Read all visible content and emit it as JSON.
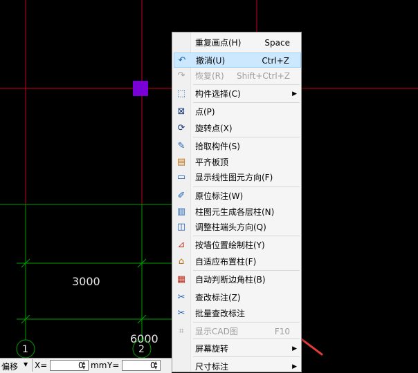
{
  "canvas": {
    "dimension_labels": [
      "3000",
      "6000"
    ],
    "axis_labels": [
      "1",
      "2"
    ]
  },
  "status_bar": {
    "mode_label": "偏移",
    "x_label": "X=",
    "x_value": "0",
    "x_unit": "mm",
    "y_label": "Y=",
    "y_value": "0"
  },
  "menu": {
    "items": [
      {
        "label": "重复画点(H)",
        "shortcut": "Space",
        "icon": "none"
      },
      {
        "label": "撤消(U)",
        "shortcut": "Ctrl+Z",
        "icon": "undo-icon",
        "highlighted": true
      },
      {
        "label": "恢复(R)",
        "shortcut": "Shift+Ctrl+Z",
        "icon": "redo-icon",
        "disabled": true
      },
      {
        "label": "构件选择(C)",
        "shortcut": "",
        "icon": "select-component-icon",
        "submenu": true
      },
      {
        "label": "点(P)",
        "shortcut": "",
        "icon": "point-icon"
      },
      {
        "label": "旋转点(X)",
        "shortcut": "",
        "icon": "rotate-point-icon"
      },
      {
        "label": "拾取构件(S)",
        "shortcut": "",
        "icon": "pick-component-icon"
      },
      {
        "label": "平齐板顶",
        "shortcut": "",
        "icon": "align-slab-top-icon"
      },
      {
        "label": "显示线性图元方向(F)",
        "shortcut": "",
        "icon": "show-direction-icon"
      },
      {
        "label": "原位标注(W)",
        "shortcut": "",
        "icon": "in-situ-annotation-icon"
      },
      {
        "label": "柱图元生成各层柱(N)",
        "shortcut": "",
        "icon": "generate-columns-icon"
      },
      {
        "label": "调整柱端头方向(Q)",
        "shortcut": "",
        "icon": "adjust-column-end-icon"
      },
      {
        "label": "按墙位置绘制柱(Y)",
        "shortcut": "",
        "icon": "draw-column-by-wall-icon"
      },
      {
        "label": "自适应布置柱(F)",
        "shortcut": "",
        "icon": "adaptive-column-icon"
      },
      {
        "label": "自动判断边角柱(B)",
        "shortcut": "",
        "icon": "corner-column-icon"
      },
      {
        "label": "查改标注(Z)",
        "shortcut": "",
        "icon": "check-annotation-icon"
      },
      {
        "label": "批量查改标注",
        "shortcut": "",
        "icon": "batch-annotation-icon"
      },
      {
        "label": "显示CAD图",
        "shortcut": "F10",
        "icon": "show-cad-icon",
        "disabled": true
      },
      {
        "label": "屏幕旋转",
        "shortcut": "",
        "icon": "none",
        "submenu": true
      },
      {
        "label": "尺寸标注",
        "shortcut": "",
        "icon": "none",
        "submenu": true
      }
    ]
  },
  "colors": {
    "background": "#000000",
    "grid_red": "#c8001e",
    "grid_green": "#00a000",
    "marker": "#7a00d8",
    "arrow": "#e33a3a",
    "highlight": "#cce8ff"
  }
}
